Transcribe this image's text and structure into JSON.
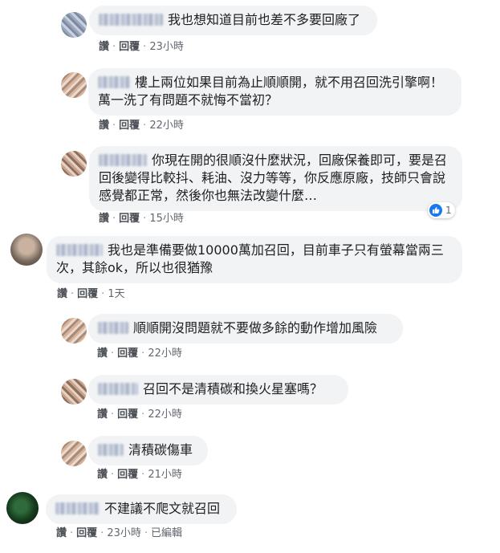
{
  "comments": [
    {
      "text": "我也想知道目前也差不多要回廠了",
      "actions": {
        "like": "讚",
        "reply": "回覆",
        "time": "23小時"
      }
    },
    {
      "text": "樓上兩位如果目前為止順順開，就不用召回洗引擎啊！萬一洗了有問題不就悔不當初？",
      "actions": {
        "like": "讚",
        "reply": "回覆",
        "time": "22小時"
      }
    },
    {
      "text": "你現在開的很順沒什麼狀況，回廠保養即可，要是召回後變得比較抖、耗油、沒力等等，你反應原廠，技師只會說感覺都正常，然後你也無法改變什麼…",
      "actions": {
        "like": "讚",
        "reply": "回覆",
        "time": "15小時"
      },
      "reaction_count": "1"
    },
    {
      "text": "我也是準備要做10000萬加召回，目前車子只有螢幕當兩三次，其餘ok，所以也很猶豫",
      "actions": {
        "like": "讚",
        "reply": "回覆",
        "time": "1天"
      }
    },
    {
      "text": "順順開沒問題就不要做多餘的動作增加風險",
      "actions": {
        "like": "讚",
        "reply": "回覆",
        "time": "22小時"
      }
    },
    {
      "text": "召回不是清積碳和換火星塞嗎？",
      "actions": {
        "like": "讚",
        "reply": "回覆",
        "time": "22小時"
      }
    },
    {
      "text": "清積碳傷車",
      "actions": {
        "like": "讚",
        "reply": "回覆",
        "time": "21小時"
      }
    },
    {
      "text": "不建議不爬文就召回",
      "actions": {
        "like": "讚",
        "reply": "回覆",
        "time": "23小時",
        "edited": "已編輯"
      }
    }
  ],
  "colors": {
    "bubble": "#f2f3f5",
    "text": "#1c1e21",
    "meta": "#606770",
    "like_blue": "#1877f2"
  },
  "icons": {
    "reaction": "like-thumb-icon"
  }
}
